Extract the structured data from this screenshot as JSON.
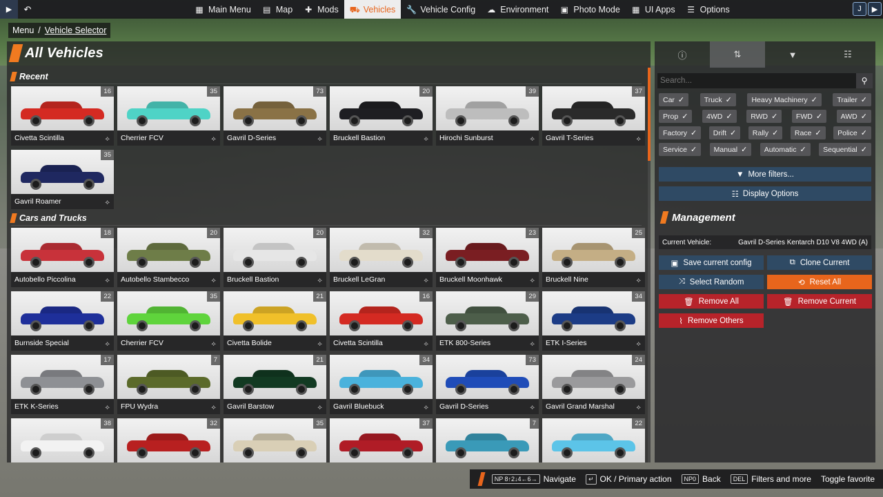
{
  "topbar": {
    "nav": [
      {
        "label": "Main Menu",
        "icon": "main-menu-icon",
        "glyph": "▦"
      },
      {
        "label": "Map",
        "icon": "map-icon",
        "glyph": "▤"
      },
      {
        "label": "Mods",
        "icon": "puzzle-icon",
        "glyph": "✚"
      },
      {
        "label": "Vehicles",
        "icon": "car-icon",
        "glyph": "⛟",
        "active": true
      },
      {
        "label": "Vehicle Config",
        "icon": "wrench-icon",
        "glyph": "🔧"
      },
      {
        "label": "Environment",
        "icon": "cloud-sun-icon",
        "glyph": "☁"
      },
      {
        "label": "Photo Mode",
        "icon": "camera-icon",
        "glyph": "▣"
      },
      {
        "label": "UI Apps",
        "icon": "apps-icon",
        "glyph": "▦"
      },
      {
        "label": "Options",
        "icon": "options-icon",
        "glyph": "☰"
      }
    ]
  },
  "breadcrumb": {
    "root": "Menu",
    "sep": "/",
    "current": "Vehicle Selector"
  },
  "page": {
    "title": "All Vehicles"
  },
  "sections": {
    "recent": "Recent",
    "cars": "Cars and Trucks"
  },
  "recent": [
    {
      "name": "Civetta Scintilla",
      "count": "16",
      "color": "#d42a22"
    },
    {
      "name": "Cherrier FCV",
      "count": "35",
      "color": "#4fd3c6"
    },
    {
      "name": "Gavril D-Series",
      "count": "73",
      "color": "#8a7246"
    },
    {
      "name": "Bruckell Bastion",
      "count": "20",
      "color": "#1e1e22"
    },
    {
      "name": "Hirochi Sunburst",
      "count": "39",
      "color": "#bdbdbd"
    },
    {
      "name": "Gavril T-Series",
      "count": "37",
      "color": "#2a2a2a"
    },
    {
      "name": "Gavril Roamer",
      "count": "35",
      "color": "#1f2860"
    }
  ],
  "cars": [
    {
      "name": "Autobello Piccolina",
      "count": "18",
      "color": "#c8323a"
    },
    {
      "name": "Autobello Stambecco",
      "count": "20",
      "color": "#6e7d48"
    },
    {
      "name": "Bruckell Bastion",
      "count": "20",
      "color": "#e6e6e6"
    },
    {
      "name": "Bruckell LeGran",
      "count": "32",
      "color": "#e3dccb"
    },
    {
      "name": "Bruckell Moonhawk",
      "count": "23",
      "color": "#7a1e22"
    },
    {
      "name": "Bruckell Nine",
      "count": "25",
      "color": "#c4ae85"
    },
    {
      "name": "Burnside Special",
      "count": "22",
      "color": "#1e2f9a"
    },
    {
      "name": "Cherrier FCV",
      "count": "35",
      "color": "#5fd43c"
    },
    {
      "name": "Civetta Bolide",
      "count": "21",
      "color": "#f0c02a"
    },
    {
      "name": "Civetta Scintilla",
      "count": "16",
      "color": "#d42a22"
    },
    {
      "name": "ETK 800-Series",
      "count": "29",
      "color": "#4d5e4a"
    },
    {
      "name": "ETK I-Series",
      "count": "34",
      "color": "#1c3c86"
    },
    {
      "name": "ETK K-Series",
      "count": "17",
      "color": "#8e9094"
    },
    {
      "name": "FPU Wydra",
      "count": "7",
      "color": "#5b6a2a"
    },
    {
      "name": "Gavril Barstow",
      "count": "21",
      "color": "#123a22"
    },
    {
      "name": "Gavril Bluebuck",
      "count": "34",
      "color": "#4ab2dc"
    },
    {
      "name": "Gavril D-Series",
      "count": "73",
      "color": "#1f4cb8"
    },
    {
      "name": "Gavril Grand Marshal",
      "count": "24",
      "color": "#9a9a9c"
    },
    {
      "name": "",
      "count": "38",
      "color": "#f2f2f2"
    },
    {
      "name": "",
      "count": "32",
      "color": "#b82020"
    },
    {
      "name": "",
      "count": "35",
      "color": "#d9cfb6"
    },
    {
      "name": "",
      "count": "37",
      "color": "#b01c26"
    },
    {
      "name": "",
      "count": "7",
      "color": "#3a9ab8"
    },
    {
      "name": "",
      "count": "22",
      "color": "#5cc4e8"
    }
  ],
  "right": {
    "tabs": [
      {
        "icon": "info-icon",
        "glyph": "ⓘ"
      },
      {
        "icon": "list-sort-icon",
        "glyph": "⇅"
      },
      {
        "icon": "filter-icon",
        "glyph": "▼"
      },
      {
        "icon": "sliders-icon",
        "glyph": "☷"
      }
    ],
    "search_placeholder": "Search...",
    "filters": [
      [
        "Car",
        "Truck",
        "Heavy Machinery",
        "Trailer"
      ],
      [
        "Prop",
        "4WD",
        "RWD",
        "FWD",
        "AWD"
      ],
      [
        "Factory",
        "Drift",
        "Rally",
        "Race",
        "Police"
      ],
      [
        "Service",
        "Manual",
        "Automatic",
        "Sequential"
      ]
    ],
    "more_filters": "More filters...",
    "display_options": "Display Options",
    "management_title": "Management",
    "current_vehicle_label": "Current Vehicle:",
    "current_vehicle_value": "Gavril D-Series Kentarch D10 V8 4WD (A)",
    "buttons": {
      "save_config": "Save current config",
      "clone_current": "Clone Current",
      "select_random": "Select Random",
      "reset_all": "Reset All",
      "remove_all": "Remove All",
      "remove_current": "Remove Current",
      "remove_others": "Remove Others"
    }
  },
  "hints": {
    "navigate_key": "NP 8↑2↓4←6→",
    "navigate": "Navigate",
    "ok_key": "↵",
    "ok": "OK / Primary action",
    "back_key": "NP0",
    "back": "Back",
    "del_key": "DEL",
    "filters": "Filters and more",
    "favorite": "Toggle favorite"
  },
  "colors": {
    "accent": "#e8651c",
    "blue_button": "#2f4a64",
    "red_button": "#b7232a"
  }
}
